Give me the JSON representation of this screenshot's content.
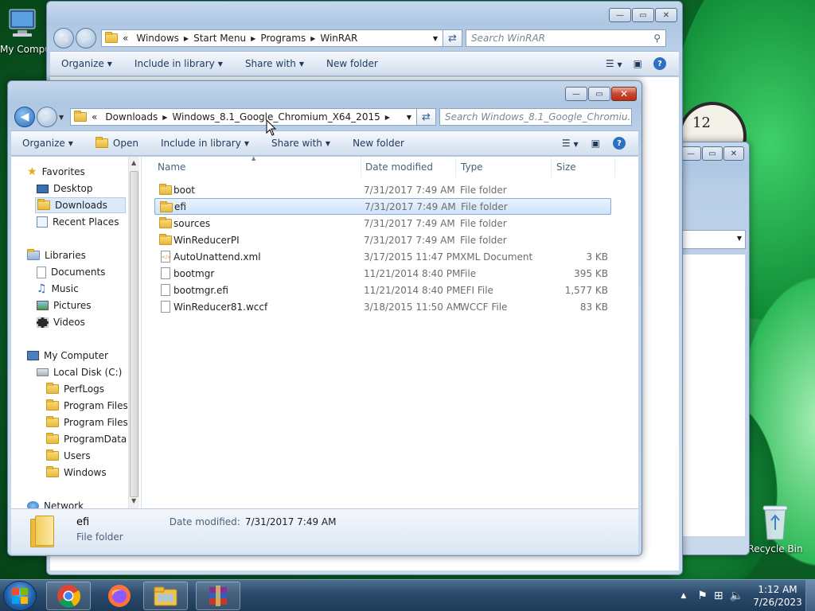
{
  "desktop": {
    "my_computer_label": "My Computer",
    "recycle_bin_label": "Recycle Bin",
    "clock_gadget_numeral": "12"
  },
  "back_window": {
    "breadcrumb": [
      "Windows",
      "Start Menu",
      "Programs",
      "WinRAR"
    ],
    "breadcrumb_prefix": "«",
    "search_placeholder": "Search WinRAR",
    "toolbar": {
      "organize": "Organize",
      "include_in_library": "Include in library",
      "share_with": "Share with",
      "new_folder": "New folder"
    }
  },
  "main_window": {
    "breadcrumb_prefix": "«",
    "breadcrumb": [
      "Downloads",
      "Windows_8.1_Google_Chromium_X64_2015"
    ],
    "search_placeholder": "Search Windows_8.1_Google_Chromiu...",
    "toolbar": {
      "organize": "Organize",
      "open": "Open",
      "include_in_library": "Include in library",
      "share_with": "Share with",
      "new_folder": "New folder"
    },
    "nav_pane": {
      "favorites": "Favorites",
      "desktop": "Desktop",
      "downloads": "Downloads",
      "recent_places": "Recent Places",
      "libraries": "Libraries",
      "documents": "Documents",
      "music": "Music",
      "pictures": "Pictures",
      "videos": "Videos",
      "my_computer": "My Computer",
      "local_disk": "Local Disk (C:)",
      "perflogs": "PerfLogs",
      "program_files": "Program Files",
      "program_files_x86": "Program Files (",
      "programdata": "ProgramData",
      "users": "Users",
      "windows": "Windows",
      "network": "Network"
    },
    "columns": {
      "name": "Name",
      "date_modified": "Date modified",
      "type": "Type",
      "size": "Size"
    },
    "files": [
      {
        "name": "boot",
        "date": "7/31/2017 7:49 AM",
        "type": "File folder",
        "size": "",
        "icon": "folder-icon"
      },
      {
        "name": "efi",
        "date": "7/31/2017 7:49 AM",
        "type": "File folder",
        "size": "",
        "icon": "folder-icon"
      },
      {
        "name": "sources",
        "date": "7/31/2017 7:49 AM",
        "type": "File folder",
        "size": "",
        "icon": "folder-icon"
      },
      {
        "name": "WinReducerPI",
        "date": "7/31/2017 7:49 AM",
        "type": "File folder",
        "size": "",
        "icon": "folder-icon"
      },
      {
        "name": "AutoUnattend.xml",
        "date": "3/17/2015 11:47 PM",
        "type": "XML Document",
        "size": "3 KB",
        "icon": "xml-file-icon"
      },
      {
        "name": "bootmgr",
        "date": "11/21/2014 8:40 PM",
        "type": "File",
        "size": "395 KB",
        "icon": "file-icon"
      },
      {
        "name": "bootmgr.efi",
        "date": "11/21/2014 8:40 PM",
        "type": "EFI File",
        "size": "1,577 KB",
        "icon": "file-icon"
      },
      {
        "name": "WinReducer81.wccf",
        "date": "3/18/2015 11:50 AM",
        "type": "WCCF File",
        "size": "83 KB",
        "icon": "file-icon"
      }
    ],
    "selected_index": 1,
    "details_pane": {
      "name": "efi",
      "date_label": "Date modified:",
      "date_value": "7/31/2017 7:49 AM",
      "type": "File folder"
    }
  },
  "taskbar": {
    "time": "1:12 AM",
    "date": "7/26/2023",
    "apps": [
      "chrome-icon",
      "firefox-icon",
      "explorer-icon",
      "winrar-icon"
    ]
  },
  "colors": {
    "selection": "#cfe3fa",
    "selection_border": "#84acdd",
    "link_text": "#1e395b"
  }
}
